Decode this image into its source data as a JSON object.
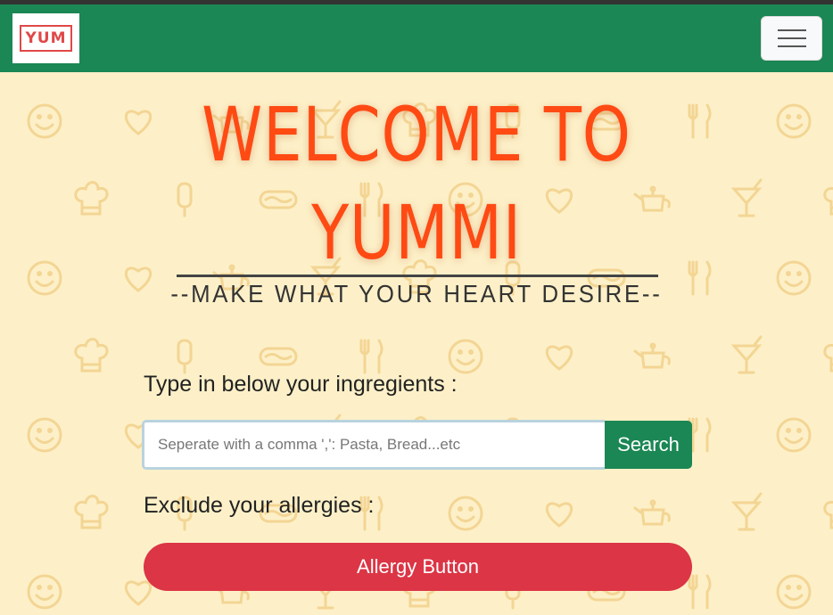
{
  "navbar": {
    "logo_text": "YUM",
    "toggler_icon": "hamburger-menu-icon",
    "brand_color": "#1b8754"
  },
  "hero": {
    "title_line1": "WELCOME TO",
    "title_line2": "YUMMI",
    "subtitle": "--MAKE WHAT YOUR HEART DESIRE--",
    "title_color": "#ff4a14"
  },
  "search": {
    "label": "Type in below your ingregients :",
    "placeholder": "Seperate with a comma ',': Pasta, Bread...etc",
    "value": "",
    "button_label": "Search"
  },
  "allergies": {
    "label": "Exclude your allergies :",
    "button_label": "Allergy Button",
    "button_color": "#dc3545"
  },
  "background": {
    "color": "#fdf0c8",
    "pattern_icons": [
      "smiley-icon",
      "cocktail-icon",
      "hotdog-icon",
      "heart-icon",
      "chef-hat-icon",
      "fork-knife-icon",
      "teapot-icon",
      "popsicle-icon"
    ]
  }
}
